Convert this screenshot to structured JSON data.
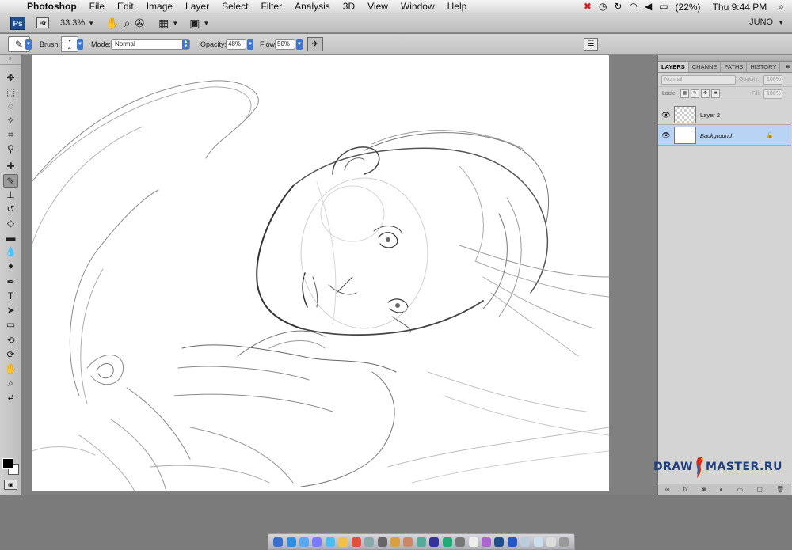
{
  "menubar": {
    "app": "Photoshop",
    "items": [
      "File",
      "Edit",
      "Image",
      "Layer",
      "Select",
      "Filter",
      "Analysis",
      "3D",
      "View",
      "Window",
      "Help"
    ],
    "battery": "(22%)",
    "clock": "Thu 9:44 PM"
  },
  "appbar": {
    "ps_label": "Ps",
    "br_label": "Br",
    "zoom": "33.3%",
    "workspace": "JUNO"
  },
  "options": {
    "brush_label": "Brush:",
    "brush_size": "4",
    "mode_label": "Mode:",
    "mode_value": "Normal",
    "opacity_label": "Opacity:",
    "opacity_value": "48%",
    "flow_label": "Flow:",
    "flow_value": "50%"
  },
  "panel": {
    "tabs": [
      "LAYERS",
      "CHANNE",
      "PATHS",
      "HISTORY"
    ],
    "blend_mode": "Normal",
    "opacity_label": "Opacity:",
    "opacity_value": "100%",
    "lock_label": "Lock:",
    "fill_label": "Fill:",
    "fill_value": "100%",
    "layers": [
      {
        "name": "Layer 2",
        "selected": false
      },
      {
        "name": "Background",
        "selected": true
      }
    ]
  },
  "watermark": {
    "left": "DRAW",
    "right": "MASTER.RU"
  },
  "colors": {
    "foreground": "#000000",
    "background": "#ffffff",
    "selection": "#b9d3f5",
    "accent": "#3f76c8"
  }
}
